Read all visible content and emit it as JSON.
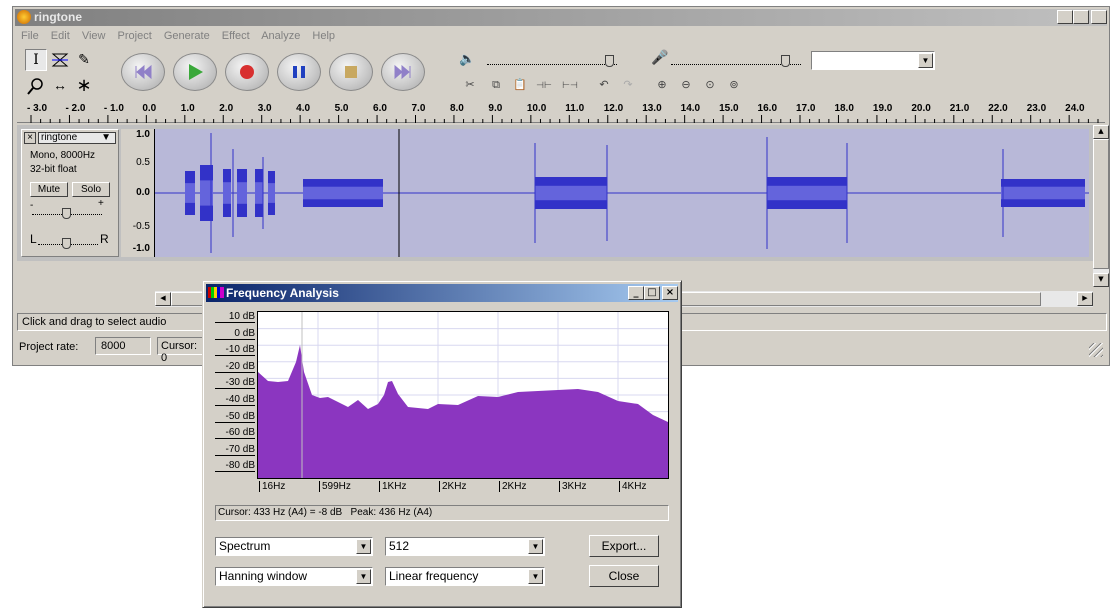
{
  "main_window": {
    "title": "ringtone",
    "menu": [
      "File",
      "Edit",
      "View",
      "Project",
      "Generate",
      "Effect",
      "Analyze",
      "Help"
    ],
    "window_controls": [
      "_",
      "□",
      "×"
    ]
  },
  "ruler": {
    "labels": [
      "- 3.0",
      "- 2.0",
      "- 1.0",
      "0.0",
      "1.0",
      "2.0",
      "3.0",
      "4.0",
      "5.0",
      "6.0",
      "7.0",
      "8.0",
      "9.0",
      "10.0",
      "11.0",
      "12.0",
      "13.0",
      "14.0",
      "15.0",
      "16.0",
      "17.0",
      "18.0",
      "19.0",
      "20.0",
      "21.0",
      "22.0",
      "23.0",
      "24.0"
    ]
  },
  "track": {
    "name": "ringtone",
    "format": "Mono, 8000Hz",
    "bit_depth": "32-bit float",
    "mute_label": "Mute",
    "solo_label": "Solo",
    "gain_minus": "-",
    "gain_plus": "+",
    "pan_left": "L",
    "pan_right": "R",
    "close_glyph": "×",
    "menu_glyph": "▼",
    "scale": [
      "1.0",
      "0.5",
      "0.0",
      "-0.5",
      "-1.0"
    ]
  },
  "status": {
    "hint": "Click and drag to select audio",
    "rate_label": "Project rate:",
    "rate_value": "8000",
    "cursor_label": "Cursor: 0"
  },
  "freq_dialog": {
    "title": "Frequency Analysis",
    "db_labels": [
      "10 dB",
      "0 dB",
      "-10 dB",
      "-20 dB",
      "-30 dB",
      "-40 dB",
      "-50 dB",
      "-60 dB",
      "-70 dB",
      "-80 dB"
    ],
    "freq_labels": [
      "16Hz",
      "599Hz",
      "1KHz",
      "2KHz",
      "2KHz",
      "3KHz",
      "4KHz"
    ],
    "readout": "Cursor: 433 Hz (A4) = -8 dB   Peak: 436 Hz (A4)",
    "algorithm": "Spectrum",
    "size": "512",
    "window_func": "Hanning window",
    "axis_mode": "Linear frequency",
    "export_label": "Export...",
    "close_label": "Close",
    "fill_color": "#8b36c0"
  }
}
